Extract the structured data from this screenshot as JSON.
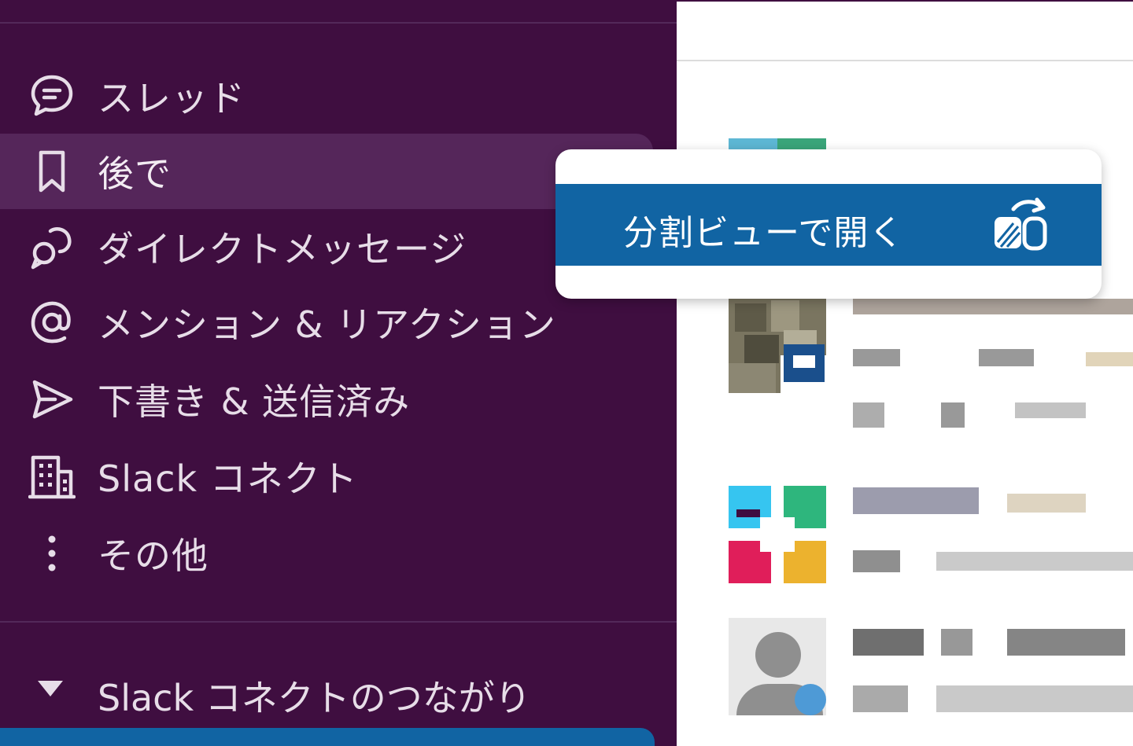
{
  "sidebar": {
    "items": [
      {
        "label": "スレッド",
        "icon": "threads-icon"
      },
      {
        "label": "後で",
        "icon": "bookmark-icon",
        "selected": true
      },
      {
        "label": "ダイレクトメッセージ",
        "icon": "direct-messages-icon"
      },
      {
        "label": "メンション & リアクション",
        "icon": "mention-icon"
      },
      {
        "label": "下書き & 送信済み",
        "icon": "send-icon"
      },
      {
        "label": "Slack コネクト",
        "icon": "building-icon"
      },
      {
        "label": "その他",
        "icon": "more-vertical-icon"
      }
    ],
    "section": {
      "label": "Slack コネクトのつながり",
      "icon": "caret-down-icon"
    }
  },
  "popup": {
    "item_label": "分割ビューで開く",
    "item_icon": "split-view-icon"
  },
  "colors": {
    "sidebar_bg": "#3f0e40",
    "selected_bg": "#55265a",
    "accent": "#1164a3",
    "sidebar_text": "#e7dde8"
  }
}
